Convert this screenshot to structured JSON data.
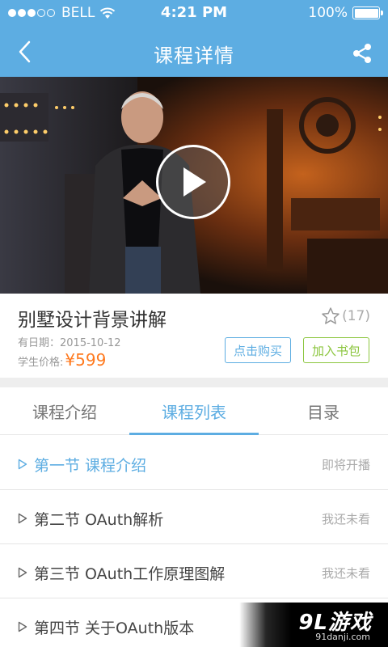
{
  "status_bar": {
    "carrier": "BELL",
    "time": "4:21 PM",
    "battery": "100%"
  },
  "nav": {
    "title": "课程详情"
  },
  "video": {
    "play_icon": "play-icon"
  },
  "course": {
    "title": "别墅设计背景讲解",
    "favorites": "(17)",
    "date": "有日期：2015-10-12",
    "price_label": "学生价格:",
    "price": "¥599",
    "buy_label": "点击购买",
    "bag_label": "加入书包"
  },
  "tabs": [
    {
      "label": "课程介绍"
    },
    {
      "label": "课程列表"
    },
    {
      "label": "目录"
    }
  ],
  "active_tab": 1,
  "lessons": [
    {
      "title": "第一节  课程介绍",
      "status": "即将开播"
    },
    {
      "title": "第二节  OAuth解析",
      "status": "我还未看"
    },
    {
      "title": "第三节  OAuth工作原理图解",
      "status": "我还未看"
    },
    {
      "title": "第四节  关于OAuth版本",
      "status": ""
    }
  ],
  "watermark": {
    "text": "9L游戏",
    "sub": "91danji.com"
  },
  "colors": {
    "accent": "#5dade2",
    "price": "#ff7a1f",
    "green": "#8cc63f"
  }
}
